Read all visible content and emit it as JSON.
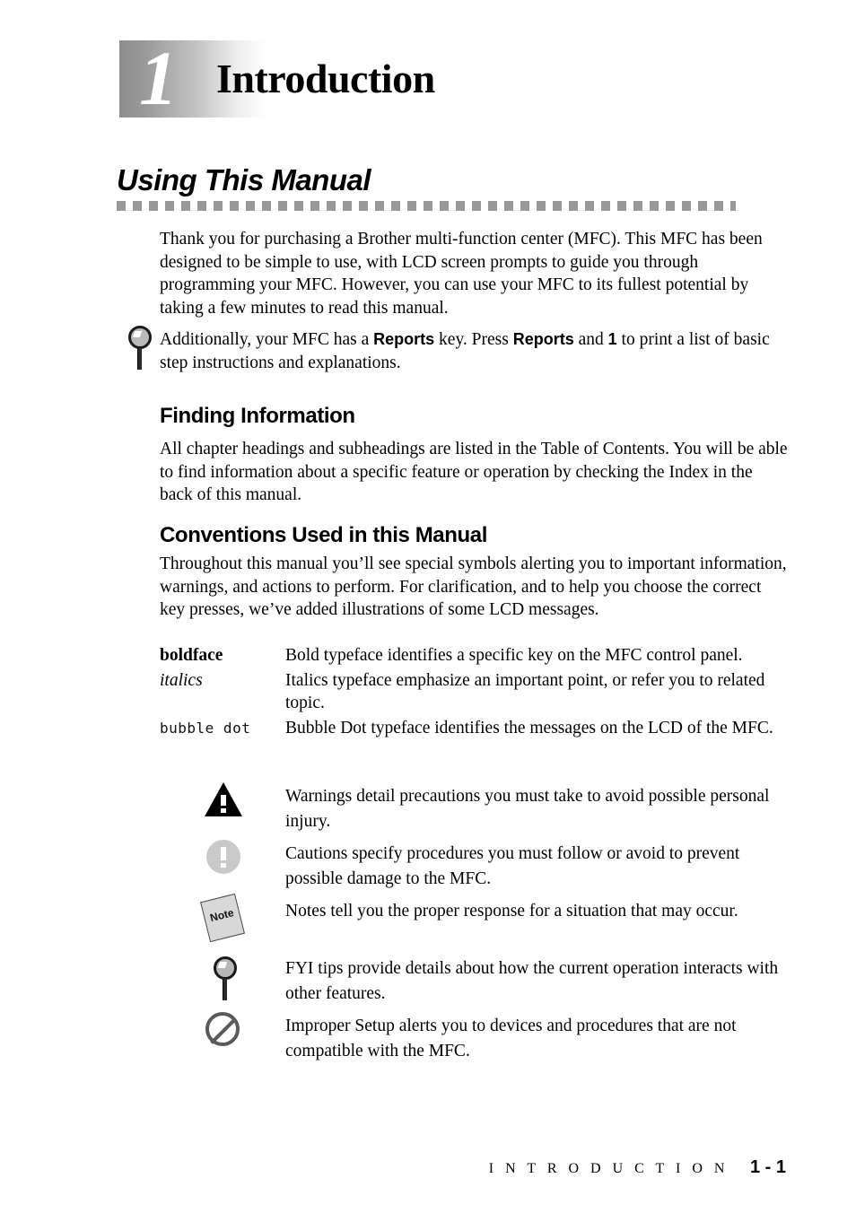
{
  "header": {
    "chapter_number": "1",
    "chapter_title": "Introduction"
  },
  "section": {
    "title": "Using This Manual"
  },
  "intro_paragraph": "Thank you for purchasing a Brother multi-function center (MFC). This MFC has been designed to be simple to use, with LCD screen prompts to guide you through programming your MFC. However, you can use your MFC to its fullest potential by taking a few minutes to read this manual.",
  "reports_note": {
    "icon": "magnifier-icon",
    "text_before": "Additionally, your MFC has a ",
    "key_1": "Reports",
    "text_middle": " key. Press ",
    "key_2": "Reports",
    "text_and": " and ",
    "key_3": "1",
    "text_after": " to print a list of basic step instructions and explanations."
  },
  "finding": {
    "heading": "Finding Information",
    "paragraph": "All chapter headings and subheadings are listed in the Table of Contents. You will be able to find information about a specific feature or operation by checking the Index in the back of this manual."
  },
  "conventions": {
    "heading": "Conventions Used in this Manual",
    "paragraph": "Throughout this manual you’ll see special symbols alerting you to important information, warnings, and actions to perform. For clarification, and to help you choose the correct key presses, we’ve added illustrations of some LCD messages.",
    "rows": [
      {
        "term": "boldface",
        "style": "boldface",
        "description": "Bold typeface identifies a specific key on the MFC control panel."
      },
      {
        "term": "italics",
        "style": "italics",
        "description": "Italics typeface emphasize an important point, or refer you to related topic."
      },
      {
        "term": "bubble dot",
        "style": "bubble",
        "description": "Bubble Dot typeface identifies the messages on the LCD of the MFC."
      }
    ]
  },
  "legend": [
    {
      "icon": "warning-triangle-icon",
      "description": "Warnings detail precautions you must take to avoid possible personal injury."
    },
    {
      "icon": "caution-circle-icon",
      "description": "Cautions specify procedures you must follow or avoid to prevent possible damage to the MFC."
    },
    {
      "icon": "note-paper-icon",
      "note_label": "Note",
      "description": "Notes tell you the proper response for a situation that may occur."
    },
    {
      "icon": "magnifier-icon",
      "description": "FYI tips provide details about how the current operation interacts with other features."
    },
    {
      "icon": "no-entry-icon",
      "description": "Improper Setup alerts you to devices and procedures that are not compatible with the MFC."
    }
  ],
  "footer": {
    "chapter_name": "I N T R O D U C T I O N",
    "page_number": "1 - 1"
  },
  "colors": {
    "badge_gradient_start": "#8d8d8d",
    "badge_gradient_end": "#ffffff",
    "rule_color": "#999999",
    "caution_gray": "#c9c9c9",
    "note_gray": "#d8d8d8",
    "no_entry_gray": "#5a5a5a"
  }
}
